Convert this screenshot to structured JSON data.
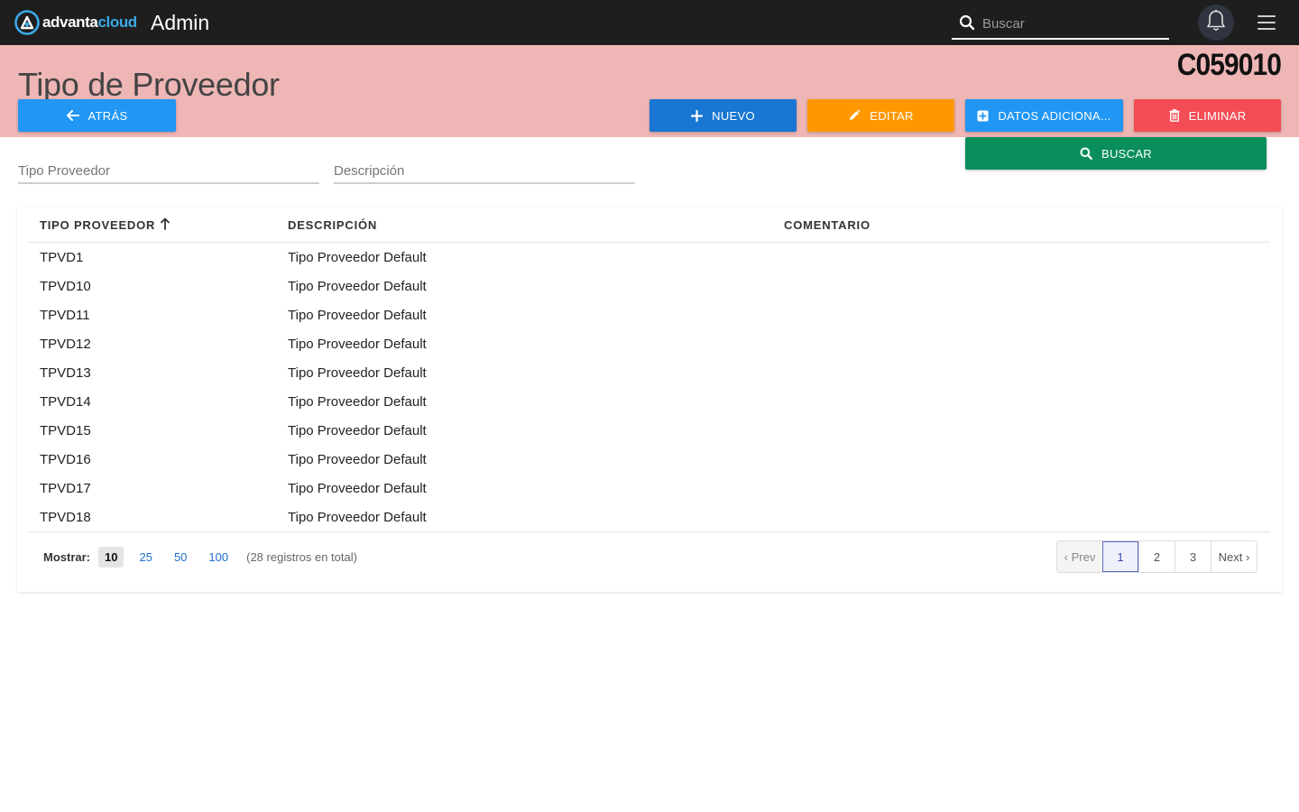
{
  "topbar": {
    "brand_part1": "advanta",
    "brand_part2": "cloud",
    "app_name": "Admin",
    "search_placeholder": "Buscar"
  },
  "page": {
    "title": "Tipo de Proveedor",
    "code": "C059010"
  },
  "actions": {
    "back_label": "ATRÁS",
    "new_label": "NUEVO",
    "edit_label": "EDITAR",
    "extra_label": "DATOS ADICIONA...",
    "delete_label": "ELIMINAR",
    "search_label": "BUSCAR"
  },
  "filters": {
    "tipo_placeholder": "Tipo Proveedor",
    "descripcion_placeholder": "Descripción"
  },
  "table": {
    "columns": [
      "TIPO PROVEEDOR",
      "DESCRIPCIÓN",
      "COMENTARIO"
    ],
    "rows": [
      {
        "tipo": "TPVD1",
        "descripcion": "Tipo Proveedor Default",
        "comentario": ""
      },
      {
        "tipo": "TPVD10",
        "descripcion": "Tipo Proveedor Default",
        "comentario": ""
      },
      {
        "tipo": "TPVD11",
        "descripcion": "Tipo Proveedor Default",
        "comentario": ""
      },
      {
        "tipo": "TPVD12",
        "descripcion": "Tipo Proveedor Default",
        "comentario": ""
      },
      {
        "tipo": "TPVD13",
        "descripcion": "Tipo Proveedor Default",
        "comentario": ""
      },
      {
        "tipo": "TPVD14",
        "descripcion": "Tipo Proveedor Default",
        "comentario": ""
      },
      {
        "tipo": "TPVD15",
        "descripcion": "Tipo Proveedor Default",
        "comentario": ""
      },
      {
        "tipo": "TPVD16",
        "descripcion": "Tipo Proveedor Default",
        "comentario": ""
      },
      {
        "tipo": "TPVD17",
        "descripcion": "Tipo Proveedor Default",
        "comentario": ""
      },
      {
        "tipo": "TPVD18",
        "descripcion": "Tipo Proveedor Default",
        "comentario": ""
      }
    ]
  },
  "footer": {
    "show_label": "Mostrar:",
    "page_sizes": [
      "10",
      "25",
      "50",
      "100"
    ],
    "selected_page_size": "10",
    "total_text": "(28 registros en total)",
    "prev_label": "‹ Prev",
    "next_label": "Next ›",
    "pages": [
      "1",
      "2",
      "3"
    ],
    "current_page": "1"
  },
  "colors": {
    "topbar": "#1e1e1e",
    "header_band": "#efb6b6",
    "back": "#2196f3",
    "new": "#1976d2",
    "edit": "#ff9800",
    "extra": "#2196f3",
    "delete": "#f44d56",
    "search": "#0a8f5c"
  },
  "icons": {
    "logo": "advanta-logo-icon",
    "search": "search-icon",
    "bell": "bell-icon",
    "menu": "hamburger-menu-icon",
    "back": "arrow-left-icon",
    "new": "plus-icon",
    "edit": "pencil-icon",
    "extra": "plus-square-icon",
    "delete": "trash-icon",
    "sort": "arrow-up-icon"
  }
}
